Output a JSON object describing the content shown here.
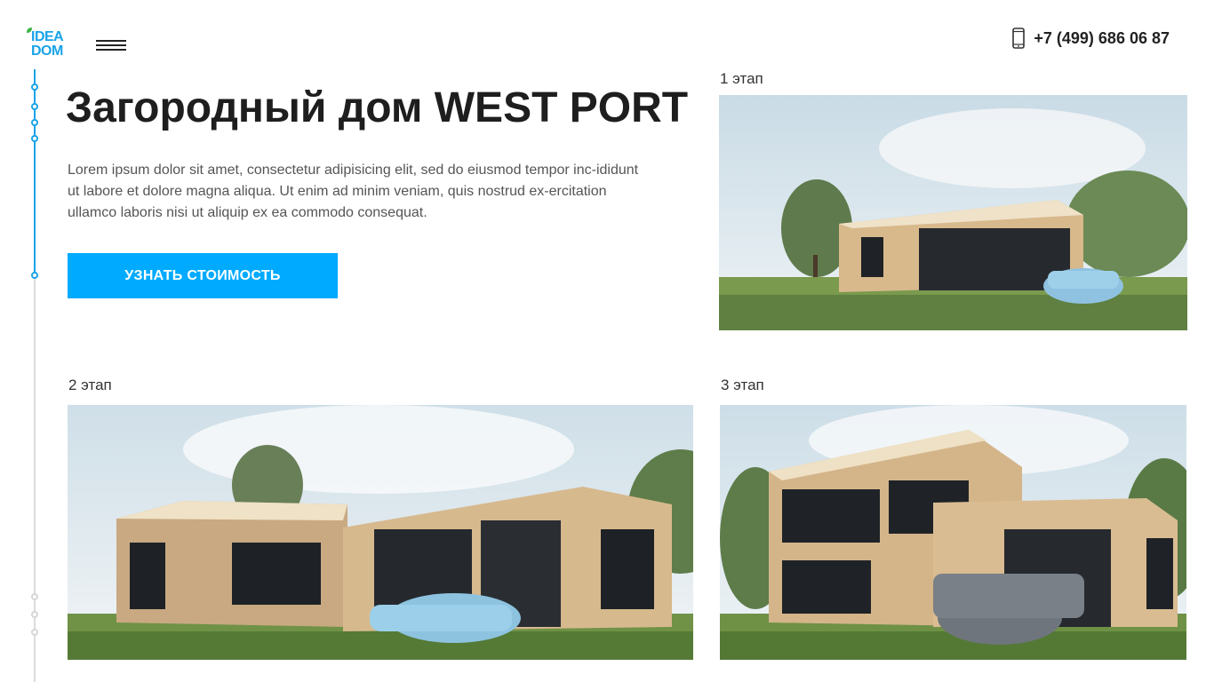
{
  "logo": {
    "line1": "IDEA",
    "line2": "DOM"
  },
  "header": {
    "phone": "+7 (499) 686 06 87",
    "menu_icon": "hamburger-menu-icon",
    "phone_icon": "smartphone-icon"
  },
  "hero": {
    "title": "Загородный дом WEST PORT",
    "description": "Lorem ipsum dolor sit amet, consectetur adipisicing elit, sed do eiusmod tempor inc-ididunt ut labore et dolore magna aliqua. Ut enim ad minim veniam, quis nostrud ex-ercitation ullamco laboris nisi ut aliquip ex ea commodo consequat.",
    "cta_label": "УЗНАТЬ СТОИМОСТЬ"
  },
  "stages": [
    {
      "label": "1 этап"
    },
    {
      "label": "2 этап"
    },
    {
      "label": "3 этап"
    }
  ],
  "colors": {
    "accent": "#00aaff",
    "timeline_active": "#1aa3e8",
    "timeline_inactive": "#dcdcdc"
  }
}
